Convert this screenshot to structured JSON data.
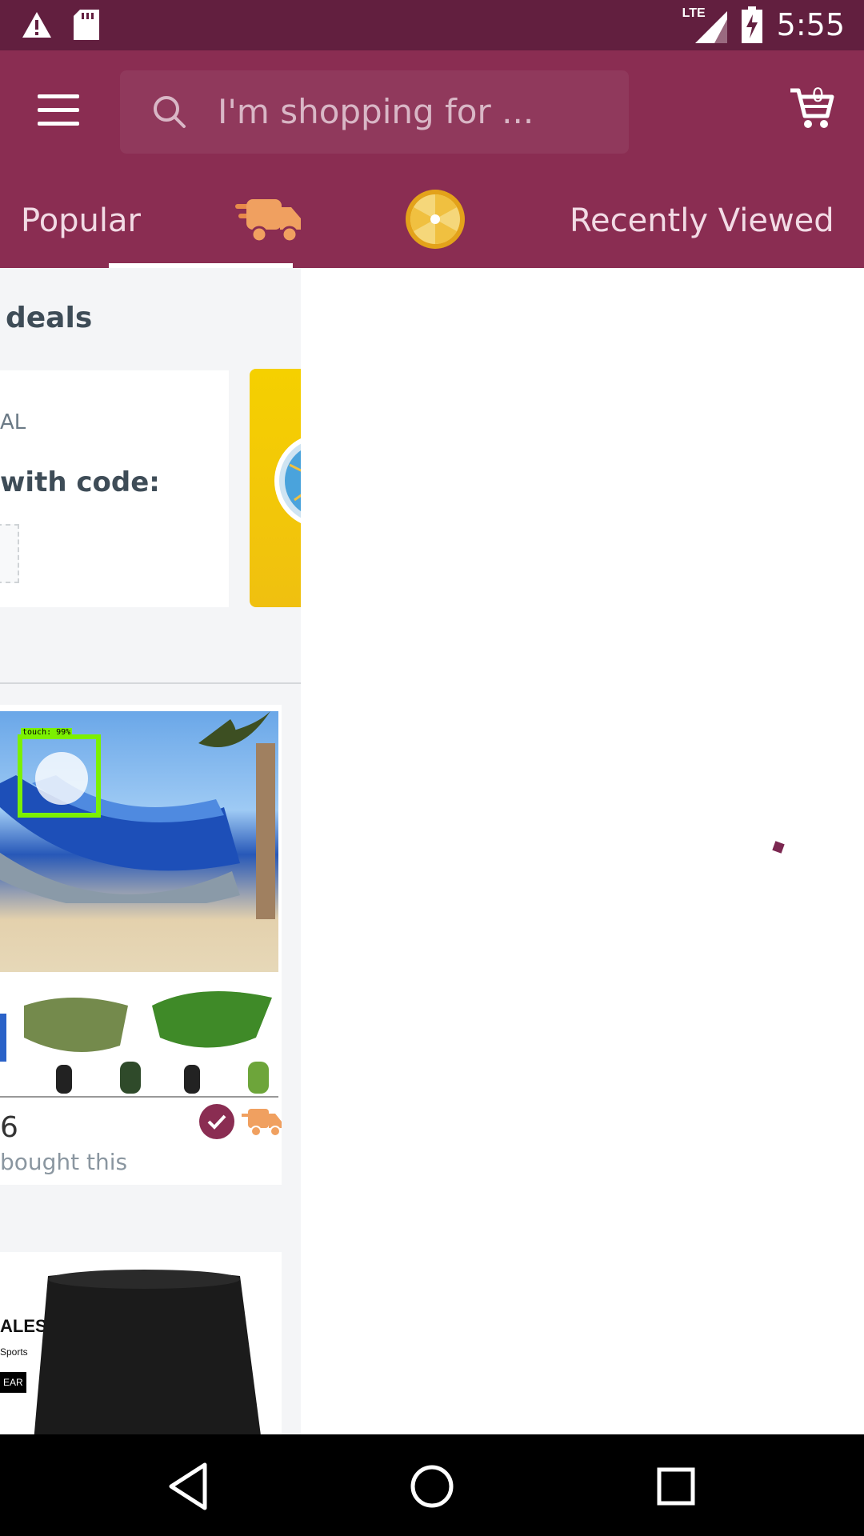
{
  "status_bar": {
    "time": "5:55",
    "network_label": "LTE",
    "icons": [
      "warning-icon",
      "sd-card-icon",
      "signal-icon",
      "battery-charging-icon"
    ]
  },
  "header": {
    "search_placeholder": "I'm shopping for ...",
    "cart_count": "0",
    "icons": [
      "menu-icon",
      "search-icon",
      "cart-icon"
    ]
  },
  "tabs": [
    {
      "label": "Popular"
    },
    {
      "label": "",
      "icon": "fast-delivery-truck-icon",
      "selected": true
    },
    {
      "label": "",
      "icon": "gold-wheel-icon"
    },
    {
      "label": "Recently Viewed"
    }
  ],
  "left_panel": {
    "section_title": "deals",
    "deal_label": "AL",
    "deal_code_text": "with code:",
    "product": {
      "price_fragment": "6",
      "bought_text": "bought this",
      "badges": [
        "verified-check-icon",
        "delivery-truck-icon"
      ]
    },
    "overlay_label": "touch: 99%",
    "shorts_text": [
      "ALES",
      "Sports",
      "EAR"
    ]
  },
  "nav": {
    "icons": [
      "back-icon",
      "home-icon",
      "recents-icon"
    ]
  }
}
